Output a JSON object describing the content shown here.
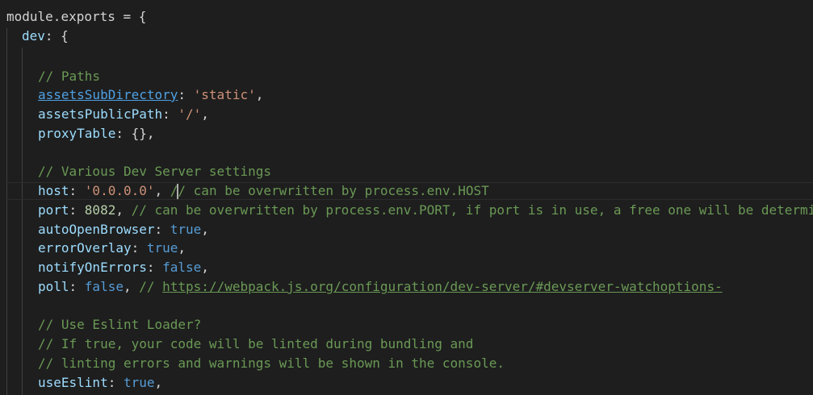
{
  "code": {
    "l01": {
      "obj": "module",
      "dot": ".",
      "prop": "exports",
      "rest": " = {"
    },
    "l02": {
      "key": "dev",
      "rest": ": {"
    },
    "l04": {
      "comment": "// Paths"
    },
    "l05": {
      "key": "assetsSubDirectory",
      "colon": ": ",
      "str": "'static'",
      "tail": ","
    },
    "l06": {
      "key": "assetsPublicPath",
      "colon": ": ",
      "str": "'/'",
      "tail": ","
    },
    "l07": {
      "key": "proxyTable",
      "colon": ": ",
      "rest": "{},"
    },
    "l09": {
      "comment": "// Various Dev Server settings"
    },
    "l10": {
      "key": "host",
      "colon": ": ",
      "str": "'0.0.0.0'",
      "tail": ", ",
      "comment_a": "/",
      "comment_b": "/ can be overwritten by process.env.HOST"
    },
    "l11": {
      "key": "port",
      "colon": ": ",
      "num": "8082",
      "tail": ", ",
      "comment": "// can be overwritten by process.env.PORT, if port is in use, a free one will be determi"
    },
    "l12": {
      "key": "autoOpenBrowser",
      "colon": ": ",
      "bool": "true",
      "tail": ","
    },
    "l13": {
      "key": "errorOverlay",
      "colon": ": ",
      "bool": "true",
      "tail": ","
    },
    "l14": {
      "key": "notifyOnErrors",
      "colon": ": ",
      "bool": "false",
      "tail": ","
    },
    "l15": {
      "key": "poll",
      "colon": ": ",
      "bool": "false",
      "tail": ", ",
      "comment": "// ",
      "url": "https://webpack.js.org/configuration/dev-server/#devserver-watchoptions-"
    },
    "l17": {
      "comment": "// Use Eslint Loader?"
    },
    "l18": {
      "comment": "// If true, your code will be linted during bundling and"
    },
    "l19": {
      "comment": "// linting errors and warnings will be shown in the console."
    },
    "l20": {
      "key": "useEslint",
      "colon": ": ",
      "bool": "true",
      "tail": ","
    }
  },
  "colors": {
    "background": "#1e1e1e",
    "default_text": "#d4d4d4",
    "property": "#9cdcfe",
    "string": "#ce9178",
    "number": "#b5cea8",
    "keyword": "#569cd6",
    "comment": "#6a9955"
  }
}
